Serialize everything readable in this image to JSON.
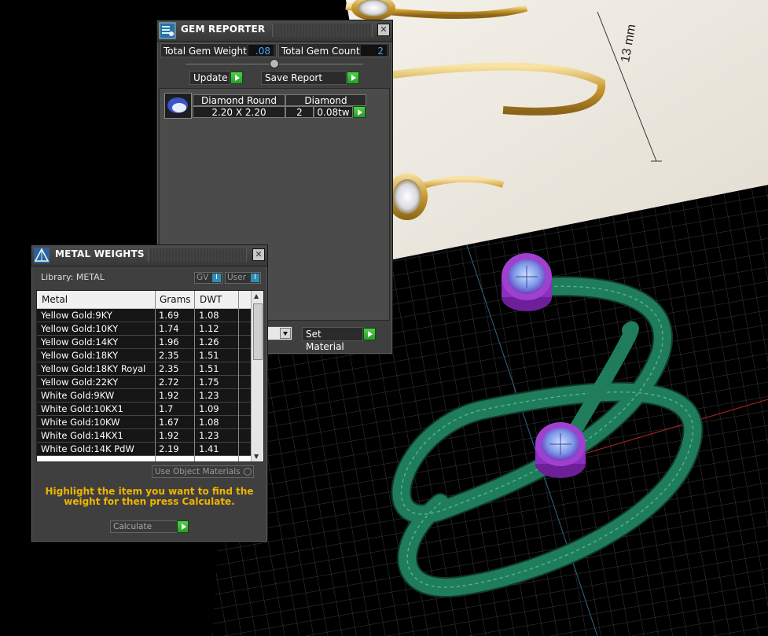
{
  "scene": {
    "reference_dimension": "13 mm"
  },
  "gem_reporter": {
    "title": "GEM REPORTER",
    "total_gem_weight_label": "Total Gem Weight",
    "total_gem_weight": ".08",
    "total_gem_count_label": "Total Gem Count",
    "total_gem_count": "2",
    "update_label": "Update",
    "save_report_label": "Save Report",
    "gem": {
      "shape": "Diamond Round",
      "material": "Diamond",
      "size": "2.20 X 2.20",
      "count": "2",
      "weight": "0.08tw"
    },
    "set_material_label": "Set Material"
  },
  "metal_weights": {
    "title": "METAL WEIGHTS",
    "library_label": "Library: METAL",
    "gv_label": "GV",
    "user_label": "User",
    "columns": [
      "Metal",
      "Grams",
      "DWT"
    ],
    "rows": [
      {
        "metal": "Yellow Gold:9KY",
        "grams": "1.69",
        "dwt": "1.08"
      },
      {
        "metal": "Yellow Gold:10KY",
        "grams": "1.74",
        "dwt": "1.12"
      },
      {
        "metal": "Yellow Gold:14KY",
        "grams": "1.96",
        "dwt": "1.26"
      },
      {
        "metal": "Yellow Gold:18KY",
        "grams": "2.35",
        "dwt": "1.51"
      },
      {
        "metal": "Yellow Gold:18KY Royal",
        "grams": "2.35",
        "dwt": "1.51"
      },
      {
        "metal": "Yellow Gold:22KY",
        "grams": "2.72",
        "dwt": "1.75"
      },
      {
        "metal": "White Gold:9KW",
        "grams": "1.92",
        "dwt": "1.23"
      },
      {
        "metal": "White Gold:10KX1",
        "grams": "1.7",
        "dwt": "1.09"
      },
      {
        "metal": "White Gold:10KW",
        "grams": "1.67",
        "dwt": "1.08"
      },
      {
        "metal": "White Gold:14KX1",
        "grams": "1.92",
        "dwt": "1.23"
      },
      {
        "metal": "White Gold:14K PdW",
        "grams": "2.19",
        "dwt": "1.41"
      }
    ],
    "use_object_materials_label": "Use Object Materials",
    "instructions": "Highlight the item you want to find the weight for then press Calculate.",
    "calculate_label": "Calculate"
  },
  "colors": {
    "panel_bg": "#3f3f3f",
    "accent_green": "#3cbc36",
    "instruction_text": "#f0b400",
    "value_blue": "#4aa9ff",
    "model_green": "#1e7a5a",
    "gem_purple": "#a040d0"
  }
}
